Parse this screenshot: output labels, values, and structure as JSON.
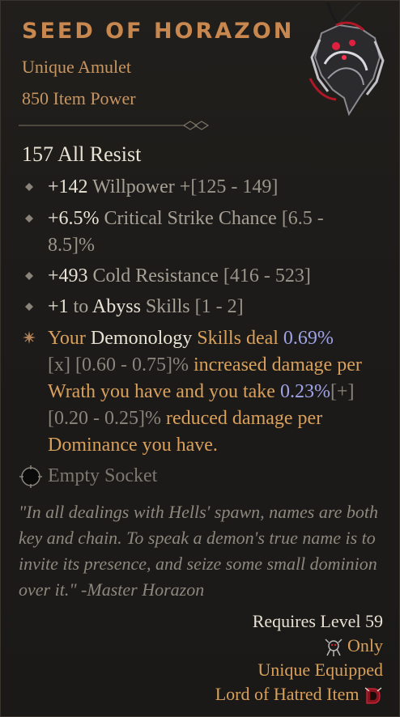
{
  "item": {
    "name": "Seed of Horazon",
    "type": "Unique Amulet",
    "power": "850 Item Power",
    "icon": "amulet-icon"
  },
  "main_stat": "157 All Resist",
  "affixes": [
    {
      "value": "+142",
      "label": " Willpower +",
      "range": "[125 - 149]"
    },
    {
      "value": "+6.5%",
      "label": " Critical Strike Chance ",
      "range": "[6.5 -",
      "range2": "8.5]%"
    },
    {
      "value": "+493",
      "label": " Cold Resistance ",
      "range": "[416 - 523]"
    },
    {
      "value": "+1",
      "label": " to ",
      "keyword": "Abyss",
      "label2": " Skills ",
      "range": "[1 - 2]"
    }
  ],
  "unique_power": {
    "p1": "Your ",
    "k1": "Demonology",
    "p2": " Skills deal ",
    "v1": "0.69%",
    "m1": "[x]",
    "r1": " [0.60 - 0.75]%",
    "p3": " increased damage per Wrath you have and you take ",
    "v2": "0.23%",
    "m2": "[+]",
    "r2": " [0.20 - 0.25]%",
    "p4": " reduced damage per Dominance you have."
  },
  "socket": {
    "label": "Empty Socket"
  },
  "flavor_text": "\"In all dealings with Hells' spawn, names are both key and chain. To speak a demon's true name is to invite its presence, and seize some small dominion over it.\" -Master Horazon",
  "requirements": {
    "level": "Requires Level 59",
    "only": "Only",
    "only_icon": "spiritborn-class-icon",
    "unique_equipped": "Unique Equipped",
    "expansion": "Lord of Hatred Item",
    "expansion_icon": "lord-of-hatred-logo-icon"
  },
  "colors": {
    "title": "#c7874e",
    "unique_text": "#d9a05c",
    "value_blue": "#9fa3e8",
    "stat_white": "#e8e2d4",
    "muted": "#a7a095"
  }
}
